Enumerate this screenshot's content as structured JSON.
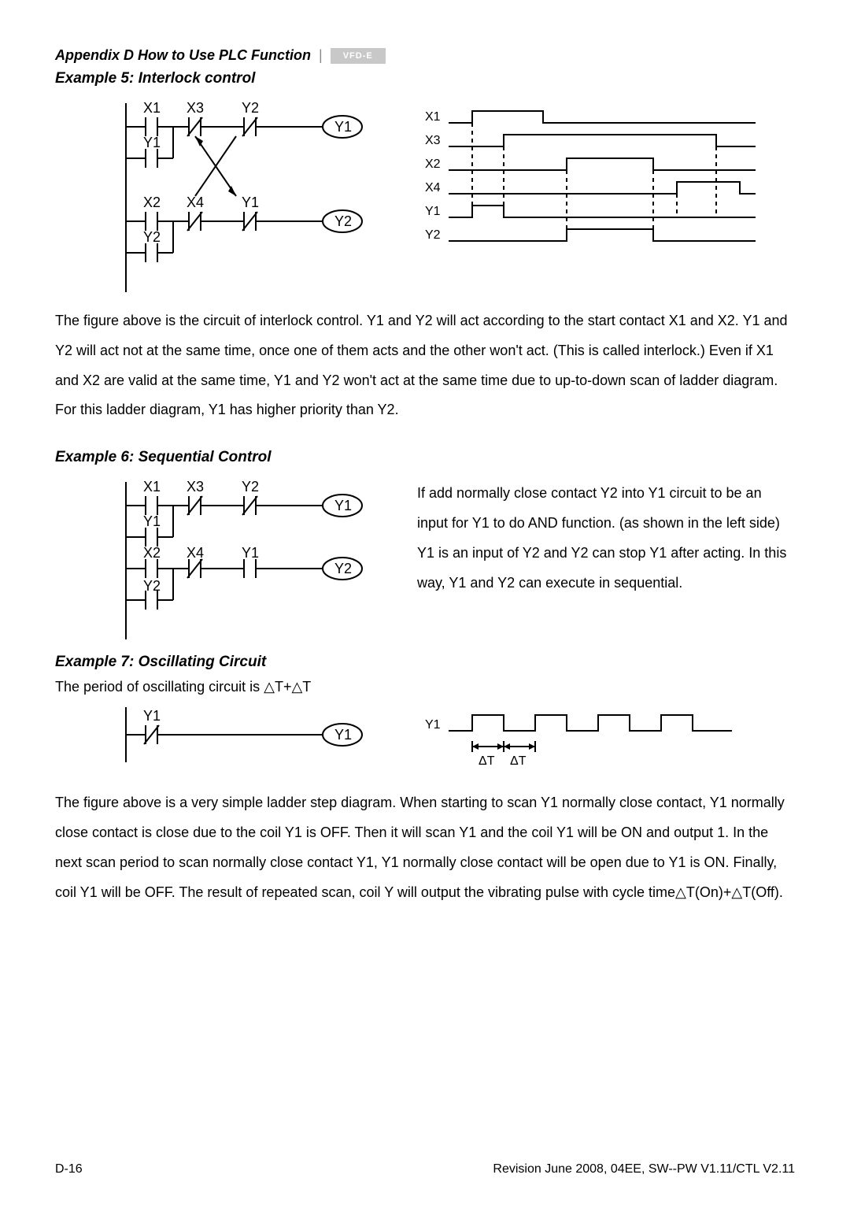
{
  "header": {
    "appendix": "Appendix D How to Use PLC Function",
    "logo_text": "VFD-E"
  },
  "example5": {
    "title": "Example 5: Interlock control",
    "ladder": {
      "rung1": {
        "contacts": [
          "X1",
          "X3",
          "Y2"
        ],
        "coil": "Y1",
        "branch": "Y1"
      },
      "rung2": {
        "contacts": [
          "X2",
          "X4",
          "Y1"
        ],
        "coil": "Y2",
        "branch": "Y2"
      }
    },
    "timing_labels": [
      "X1",
      "X3",
      "X2",
      "X4",
      "Y1",
      "Y2"
    ],
    "description": "The figure above is the circuit of interlock control. Y1 and Y2 will act according to the start contact X1 and X2. Y1 and Y2 will act not at the same time, once one of them acts and the other won't act. (This is called interlock.) Even if X1 and X2 are valid at the same time, Y1 and Y2 won't act at the same time due to up-to-down scan of ladder diagram. For this ladder diagram, Y1 has higher priority than Y2."
  },
  "example6": {
    "title": "Example 6: Sequential Control",
    "ladder": {
      "rung1": {
        "contacts": [
          "X1",
          "X3",
          "Y2"
        ],
        "coil": "Y1",
        "branch": "Y1"
      },
      "rung2": {
        "contacts": [
          "X2",
          "X4",
          "Y1"
        ],
        "coil": "Y2",
        "branch": "Y2"
      }
    },
    "description": "If add normally close contact Y2 into Y1 circuit to be an input for Y1 to do AND function. (as shown in the left side)  Y1 is an input of Y2 and Y2 can stop Y1 after acting. In this way, Y1 and Y2 can execute in sequential."
  },
  "example7": {
    "title": "Example 7: Oscillating Circuit",
    "intro": "The period of oscillating circuit is △T+△T",
    "ladder": {
      "contact": "Y1",
      "coil": "Y1"
    },
    "timing": {
      "label": "Y1",
      "dt1": "ΔT",
      "dt2": "ΔT"
    },
    "description": "The figure above is a very simple ladder step diagram. When starting to scan Y1 normally close contact, Y1 normally close contact is close due to the coil Y1 is OFF. Then it will scan Y1 and the coil Y1 will be ON and output 1. In the next scan period to scan normally close contact Y1, Y1 normally close contact will be open due to Y1 is ON. Finally, coil Y1 will be OFF. The result of repeated scan, coil Y will output the vibrating pulse with cycle time△T(On)+△T(Off)."
  },
  "footer": {
    "left": "D-16",
    "right": "Revision June 2008, 04EE, SW--PW V1.11/CTL V2.11"
  }
}
